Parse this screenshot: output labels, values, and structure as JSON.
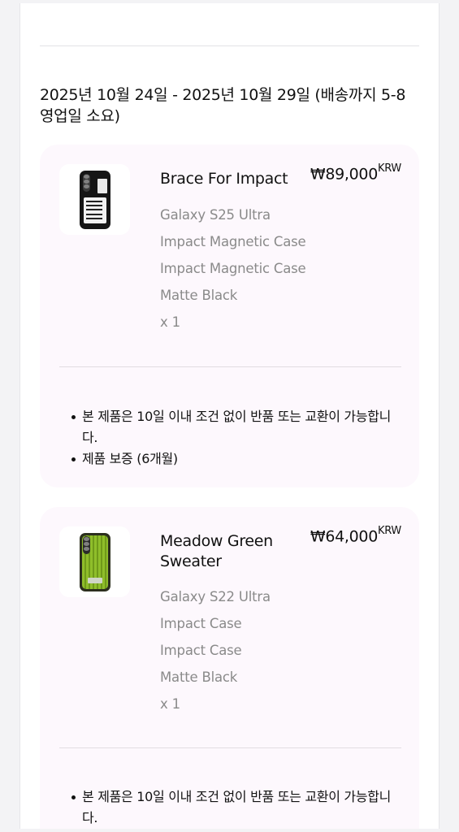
{
  "delivery": {
    "text": "2025년 10월 24일 - 2025년 10월 29일 (배송까지 5-8 영업일 소요)"
  },
  "items": [
    {
      "name": "Brace For Impact",
      "price": "₩89,000",
      "currency": "KRW",
      "device": "Galaxy S25 Ultra",
      "case_type": "Impact Magnetic Case",
      "case_type_2": "Impact Magnetic Case",
      "color": "Matte Black",
      "quantity": "x 1",
      "notes": [
        "본 제품은 10일 이내 조건 없이 반품 또는 교환이 가능합니다.",
        "제품 보증 (6개월)"
      ]
    },
    {
      "name": "Meadow Green Sweater",
      "price": "₩64,000",
      "currency": "KRW",
      "device": "Galaxy S22 Ultra",
      "case_type": "Impact Case",
      "case_type_2": "Impact Case",
      "color": "Matte Black",
      "quantity": "x 1",
      "notes": [
        "본 제품은 10일 이내 조건 없이 반품 또는 교환이 가능합니다."
      ]
    }
  ],
  "icons": [
    "phone-case-black-icon",
    "phone-case-green-icon"
  ],
  "colors": {
    "card_bg": "#fdf8fd",
    "muted_text": "#8a8a8a",
    "text": "#111111"
  }
}
